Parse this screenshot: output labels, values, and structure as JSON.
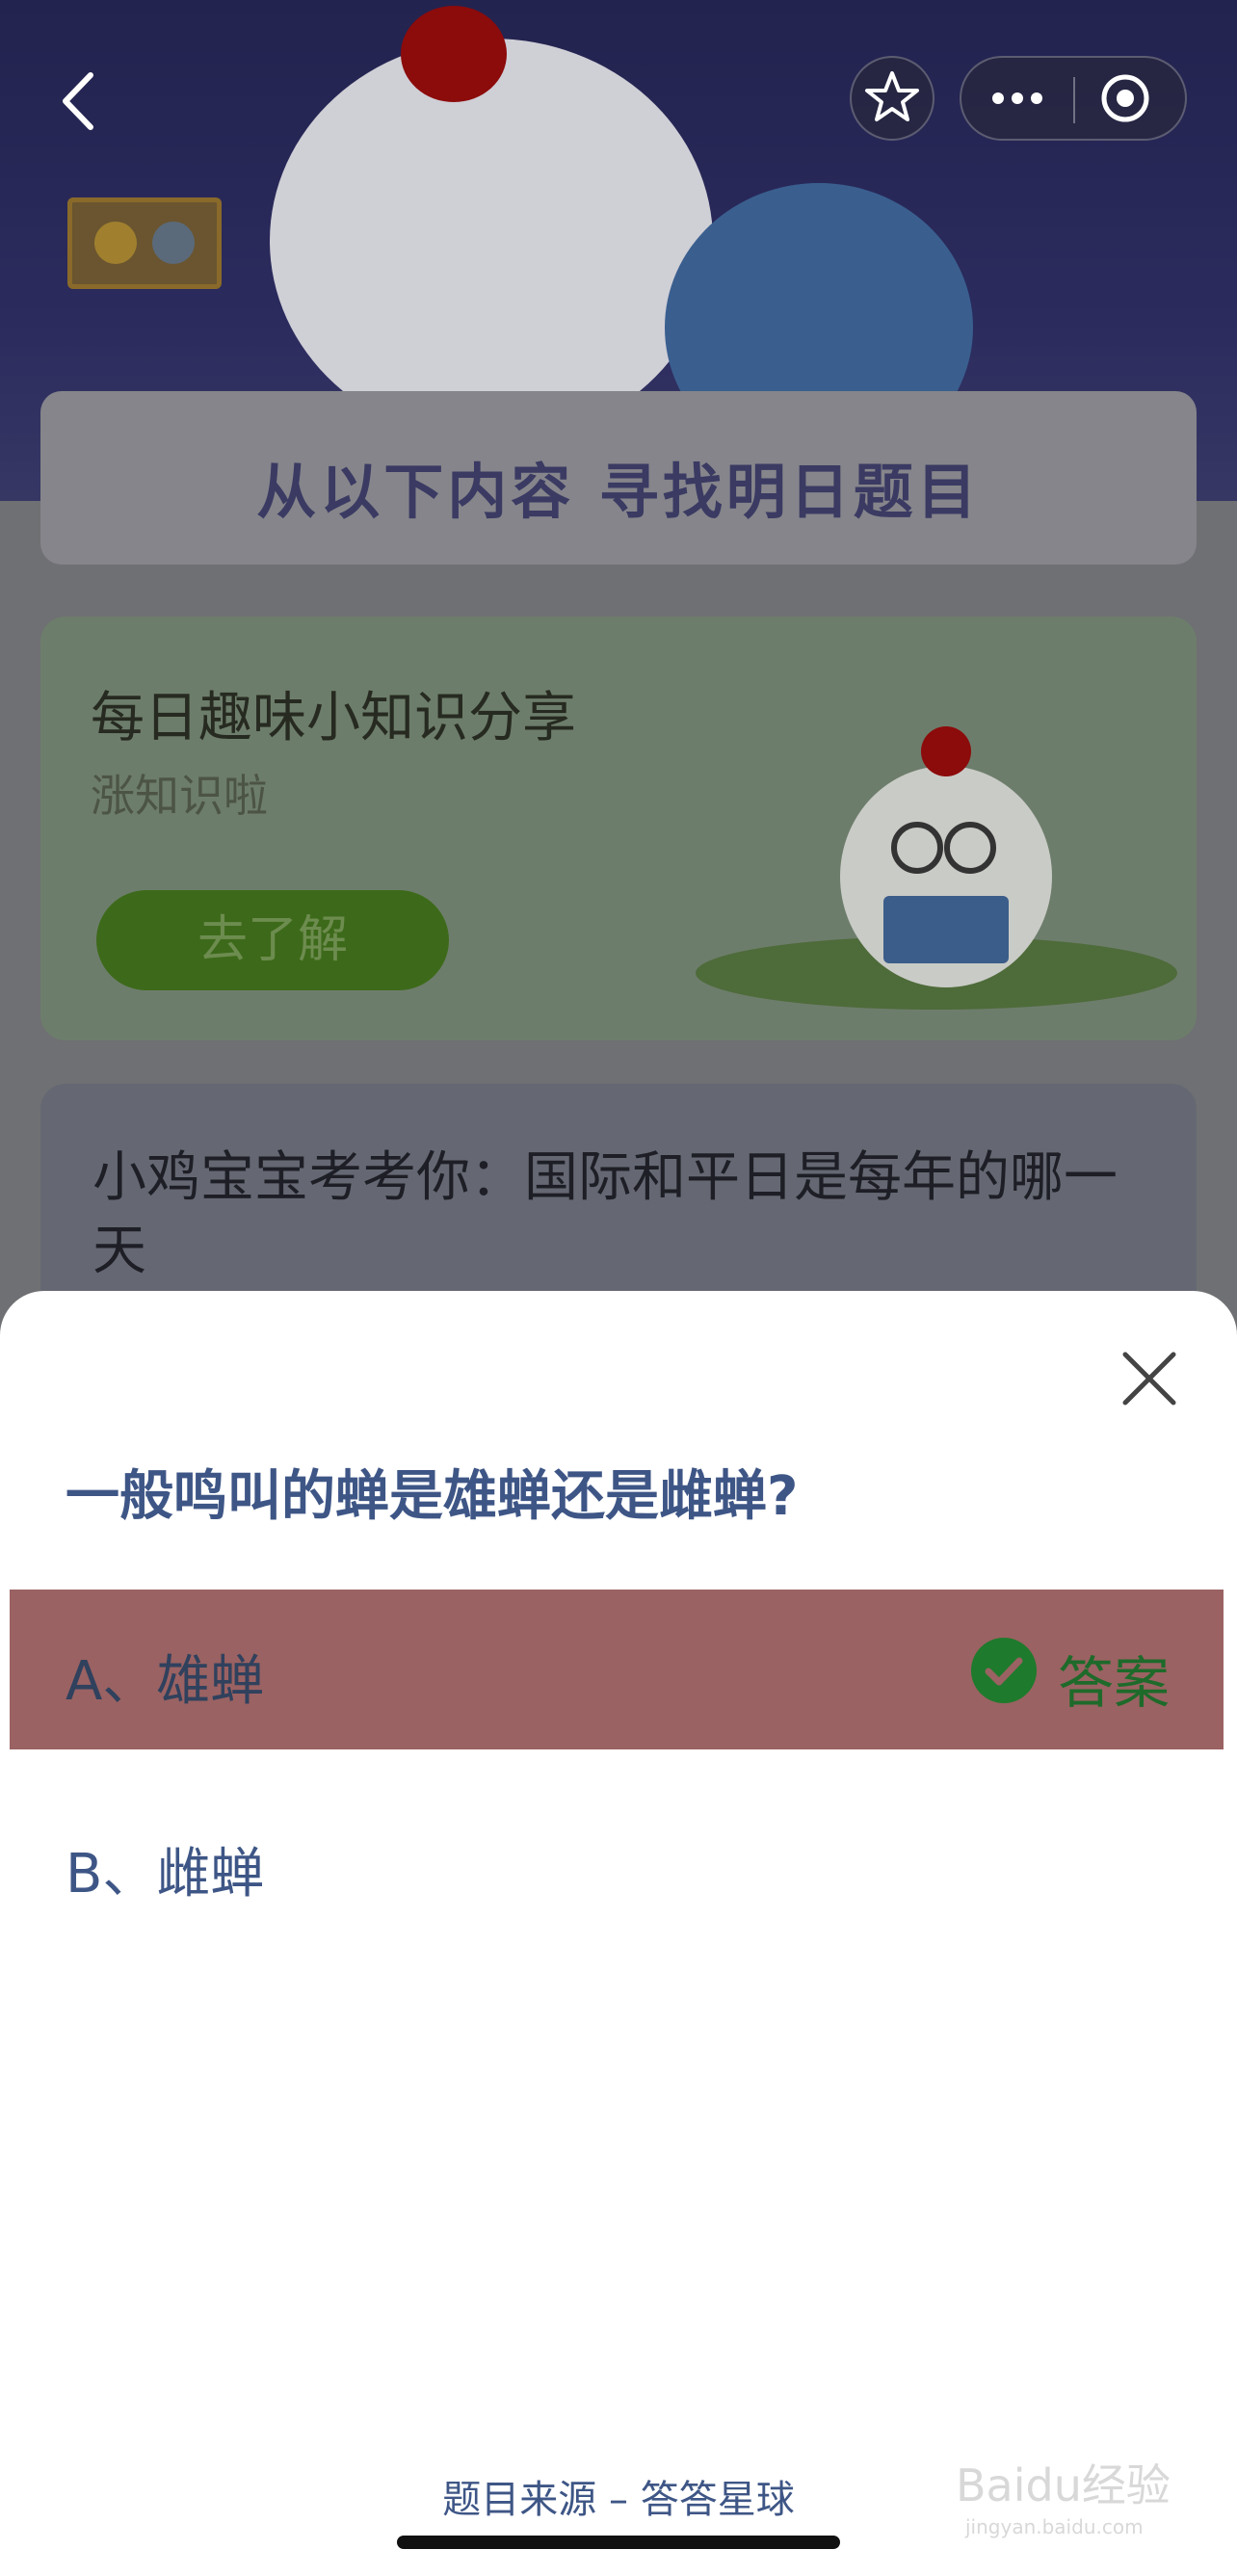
{
  "banner": {
    "title": "从以下内容  寻找明日题目"
  },
  "info_card": {
    "title": "每日趣味小知识分享",
    "subtitle": "涨知识啦",
    "button_label": "去了解"
  },
  "question_card": {
    "text": "小鸡宝宝考考你：国际和平日是每年的哪一天"
  },
  "sheet": {
    "question": "一般鸣叫的蝉是雄蝉还是雌蝉?",
    "options": [
      {
        "label": "A、雄蝉",
        "is_answer": true
      },
      {
        "label": "B、雌蝉",
        "is_answer": false
      }
    ],
    "answer_label": "答案",
    "footer": "题目来源 – 答答星球"
  },
  "watermark": {
    "text": "Baidu经验",
    "sub": "jingyan.baidu.com"
  },
  "colors": {
    "question_blue": "#3e5686",
    "answer_bg": "#9a6262",
    "answer_green": "#1e7a2c"
  },
  "icons": [
    "back-arrow-icon",
    "star-check-icon",
    "more-dots-icon",
    "target-icon",
    "close-icon",
    "check-circle-icon"
  ]
}
